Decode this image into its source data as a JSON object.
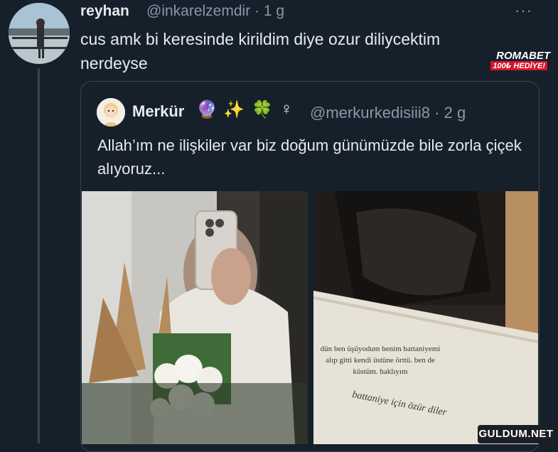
{
  "tweet": {
    "name": "reyhan",
    "handle_time": "@inkarelzemdir · 1 g",
    "more": "···",
    "text": "cus amk bi keresinde kirildim diye ozur diliycektim nerdeyse"
  },
  "quote": {
    "name": "Merkür",
    "emojis": [
      "🔮",
      "✨",
      "🍀",
      "♀"
    ],
    "handle_time": "@merkurkedisiii8 · 2 g",
    "text": "Allah’ım ne ilişkiler var biz doğum günümüzde bile zorla çiçek alıyoruz...",
    "card_text": "dün ben üşüyodum benim battaniyemi alıp gitti kendi üstüne örttü. ben de küstüm. haklıyım",
    "handwritten": "battaniye için özür diler"
  },
  "promo": {
    "brand": "ROMABET",
    "tagline": "100₺ HEDİYE!"
  },
  "watermark": "GULDUM.NET",
  "colors": {
    "background": "#15202b",
    "border": "#38444d",
    "secondary_text": "#8899a6",
    "primary_text": "#e8eaed"
  }
}
